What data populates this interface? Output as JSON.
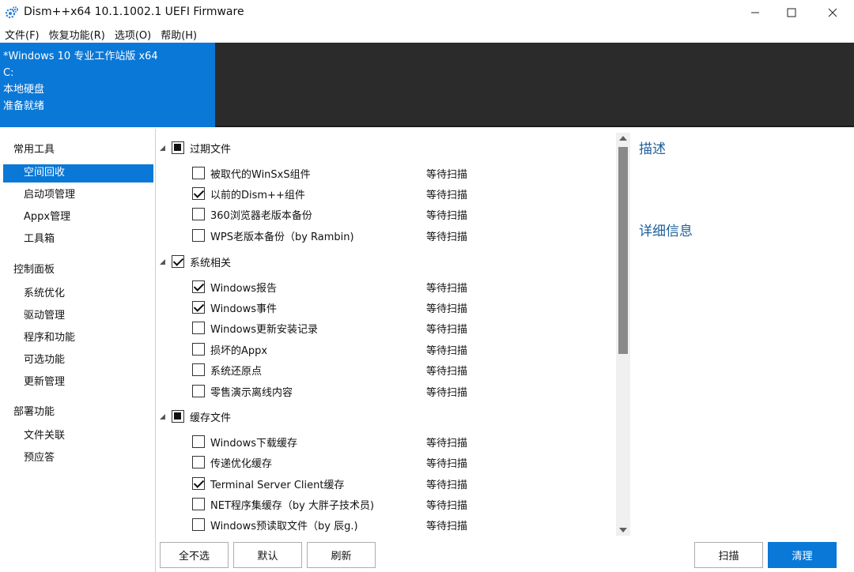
{
  "window": {
    "title": "Dism++x64 10.1.1002.1 UEFI Firmware",
    "icon": "gear-icon"
  },
  "menu": [
    "文件(F)",
    "恢复功能(R)",
    "选项(O)",
    "帮助(H)"
  ],
  "header": {
    "lines": [
      "*Windows 10 专业工作站版 x64",
      "C:",
      "本地硬盘",
      "准备就绪"
    ],
    "accent": "#0a78d7",
    "background": "#2b2b2b"
  },
  "sidebar": {
    "categories": [
      {
        "label": "常用工具",
        "items": [
          "空间回收",
          "启动项管理",
          "Appx管理",
          "工具箱"
        ]
      },
      {
        "label": "控制面板",
        "items": [
          "系统优化",
          "驱动管理",
          "程序和功能",
          "可选功能",
          "更新管理"
        ]
      },
      {
        "label": "部署功能",
        "items": [
          "文件关联",
          "预应答"
        ]
      }
    ],
    "active_item": "空间回收"
  },
  "groups": [
    {
      "label": "过期文件",
      "state": "partial",
      "items": [
        {
          "label": "被取代的WinSxS组件",
          "checked": false,
          "status": "等待扫描"
        },
        {
          "label": "以前的Dism++组件",
          "checked": true,
          "status": "等待扫描"
        },
        {
          "label": "360浏览器老版本备份",
          "checked": false,
          "status": "等待扫描"
        },
        {
          "label": "WPS老版本备份（by Rambin)",
          "checked": false,
          "status": "等待扫描"
        }
      ]
    },
    {
      "label": "系统相关",
      "state": "checked",
      "items": [
        {
          "label": "Windows报告",
          "checked": true,
          "status": "等待扫描"
        },
        {
          "label": "Windows事件",
          "checked": true,
          "status": "等待扫描"
        },
        {
          "label": "Windows更新安装记录",
          "checked": false,
          "status": "等待扫描"
        },
        {
          "label": "损坏的Appx",
          "checked": false,
          "status": "等待扫描"
        },
        {
          "label": "系统还原点",
          "checked": false,
          "status": "等待扫描"
        },
        {
          "label": "零售演示离线内容",
          "checked": false,
          "status": "等待扫描"
        }
      ]
    },
    {
      "label": "缓存文件",
      "state": "partial",
      "items": [
        {
          "label": "Windows下载缓存",
          "checked": false,
          "status": "等待扫描"
        },
        {
          "label": "传递优化缓存",
          "checked": false,
          "status": "等待扫描"
        },
        {
          "label": "Terminal Server Client缓存",
          "checked": true,
          "status": "等待扫描"
        },
        {
          "label": "NET程序集缓存（by 大胖子技术员)",
          "checked": false,
          "status": "等待扫描"
        },
        {
          "label": "Windows预读取文件（by 辰g.)",
          "checked": false,
          "status": "等待扫描"
        }
      ]
    }
  ],
  "right_panel": {
    "description_title": "描述",
    "details_title": "详细信息"
  },
  "buttons": {
    "select_none": "全不选",
    "default": "默认",
    "refresh": "刷新",
    "scan": "扫描",
    "clean": "清理"
  }
}
